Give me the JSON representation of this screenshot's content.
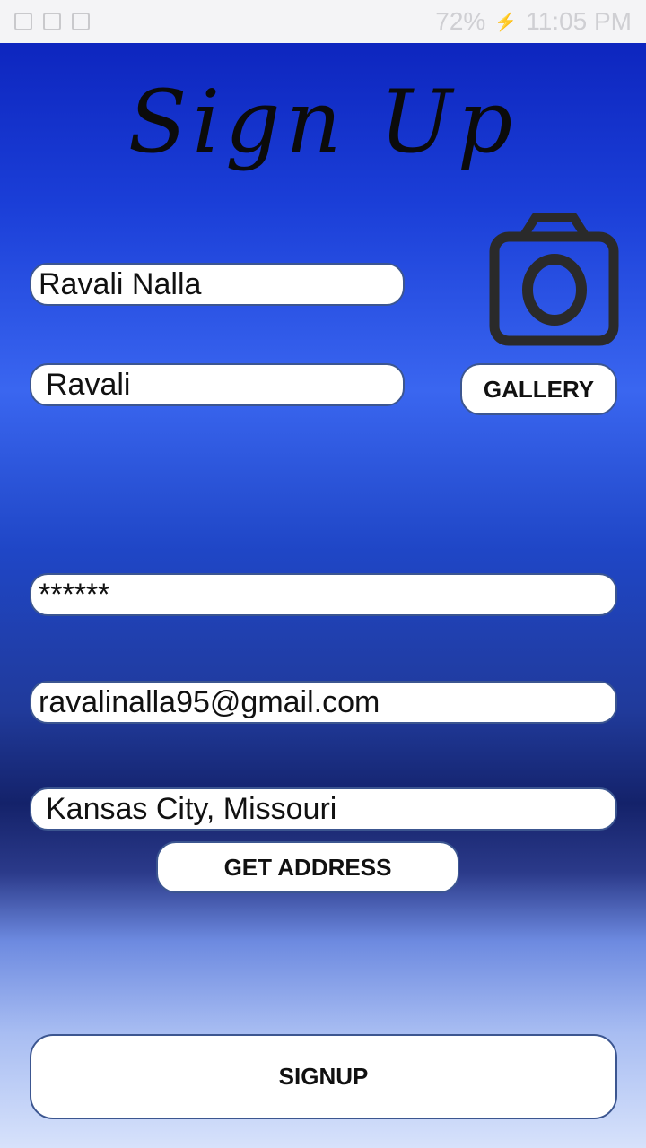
{
  "status_bar": {
    "battery": "72%",
    "time": "11:05 PM"
  },
  "title": "Sign Up",
  "form": {
    "full_name": "Ravali Nalla",
    "username": "Ravali",
    "password": "******",
    "email": "ravalinalla95@gmail.com",
    "address": "Kansas City, Missouri"
  },
  "buttons": {
    "gallery": "GALLERY",
    "get_address": "GET ADDRESS",
    "signup": "SIGNUP"
  },
  "icons": {
    "camera": "camera-icon"
  }
}
